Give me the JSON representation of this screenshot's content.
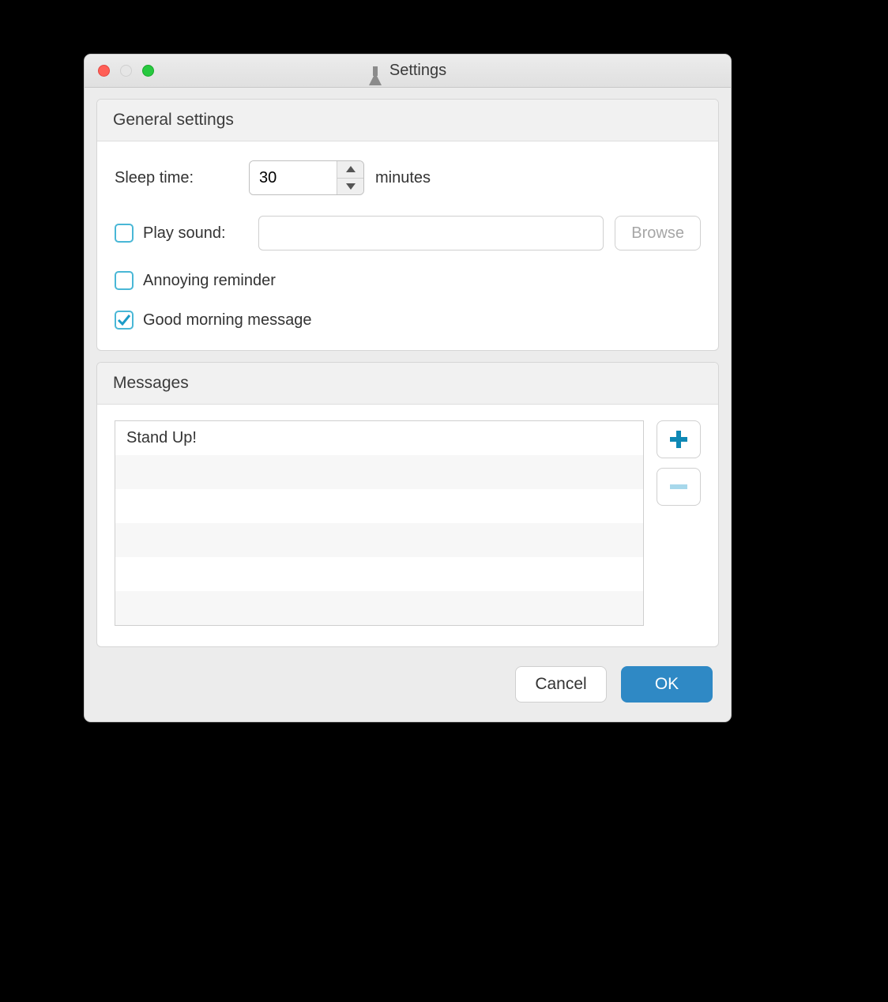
{
  "window": {
    "title": "Settings"
  },
  "general": {
    "header": "General settings",
    "sleep_label": "Sleep time:",
    "sleep_value": "30",
    "sleep_suffix": "minutes",
    "play_sound_label": "Play sound:",
    "play_sound_checked": false,
    "sound_path": "",
    "browse_label": "Browse",
    "annoying_label": "Annoying reminder",
    "annoying_checked": false,
    "good_morning_label": "Good morning message",
    "good_morning_checked": true
  },
  "messages": {
    "header": "Messages",
    "items": [
      "Stand Up!"
    ]
  },
  "footer": {
    "cancel": "Cancel",
    "ok": "OK"
  }
}
